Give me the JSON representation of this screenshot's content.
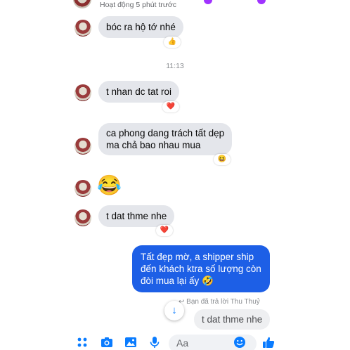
{
  "header": {
    "status": "Hoạt động 5 phút trước"
  },
  "messages": {
    "m1": {
      "text": "bóc ra hộ tớ nhé",
      "reaction": "👍"
    },
    "time1": "11:13",
    "m2": {
      "text": "t nhan dc tat roi",
      "reaction": "❤️"
    },
    "m3": {
      "line1": "ca phong dang trách tất dẹp",
      "line2": "ma chả bao nhau mua",
      "reaction": "😆"
    },
    "m4": {
      "emoji": "😂"
    },
    "m5": {
      "text": "t dat thme nhe",
      "reaction": "❤️"
    },
    "m6": {
      "line1": "Tất đẹp mờ, a shipper ship",
      "line2": "đến khách ktra số lượng còn",
      "line3": "đòi mua lại ấy 🤣"
    },
    "reply_note": "Bạn đã trả lời Thu Thuỷ",
    "reply_text": "t dat thme nhe"
  },
  "composer": {
    "placeholder": "Aa",
    "icons": [
      "menu-dots-icon",
      "camera-icon",
      "image-icon",
      "microphone-icon",
      "emoji-icon",
      "like-icon"
    ]
  },
  "colors": {
    "outgoing": "#1d5fe6",
    "incoming": "#e4e6eb",
    "accent": "#0a7cff"
  }
}
